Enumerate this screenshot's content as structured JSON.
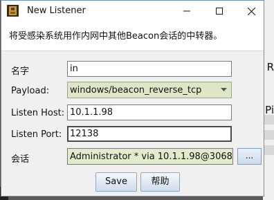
{
  "window": {
    "title": "New Listener",
    "description": "将受感染系统用作内网中其他Beacon会话的中转器。"
  },
  "background": {
    "fragment_1": "R",
    "fragment_2": "Pi"
  },
  "form": {
    "name_label": "名字",
    "name_value": "in",
    "payload_label": "Payload:",
    "payload_value": "windows/beacon_reverse_tcp",
    "listen_host_label": "Listen Host:",
    "listen_host_value": "10.1.1.98",
    "listen_port_label": "Listen Port:",
    "listen_port_value": "12138",
    "session_label": "会话",
    "session_value": "Administrator * via  10.1.1.98@3068",
    "browse_label": "..."
  },
  "buttons": {
    "save": "Save",
    "help": "帮助"
  },
  "colors": {
    "accent_field": "#dfe6c8",
    "window_border": "#6c8fb5"
  }
}
